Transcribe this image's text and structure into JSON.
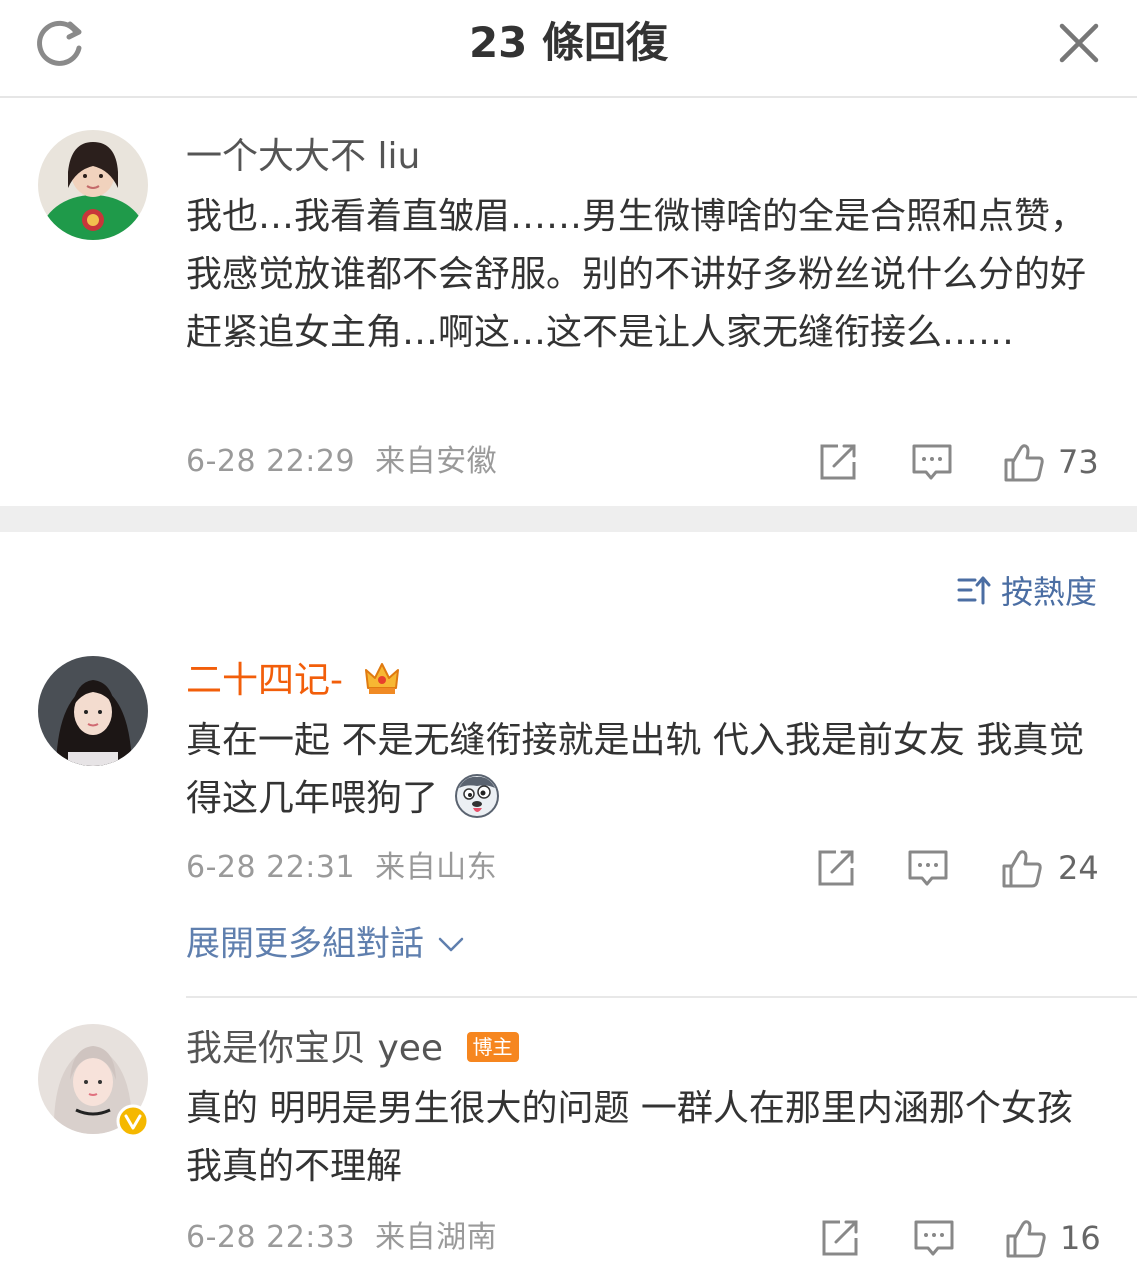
{
  "header": {
    "title": "23 條回復",
    "refresh_icon": "refresh-icon",
    "close_icon": "close-icon"
  },
  "sort_label": "按熱度",
  "expand_label": "展開更多組對話",
  "comments": [
    {
      "username": "一个大大不 liu",
      "text": "我也…我看着直皱眉……男生微博啥的全是合照和点赞，我感觉放谁都不会舒服。别的不讲好多粉丝说什么分的好赶紧追女主角…啊这…这不是让人家无缝衔接么……",
      "time": "6-28 22:29",
      "location": "来自安徽",
      "likes": "73"
    },
    {
      "username": "二十四记-",
      "username_color": "#f25e0a",
      "text": "真在一起 不是无缝衔接就是出轨 代入我是前女友 我真觉得这几年喂狗了",
      "time": "6-28 22:31",
      "location": "来自山东",
      "likes": "24"
    },
    {
      "username": "我是你宝贝 yee",
      "badge": "博主",
      "text": "真的 明明是男生很大的问题 一群人在那里内涵那个女孩 我真的不理解",
      "time": "6-28 22:33",
      "location": "来自湖南",
      "likes": "16"
    }
  ],
  "colors": {
    "accent_blue": "#5f7fae",
    "vip_orange": "#f25e0a",
    "badge_orange": "#f6861f",
    "verified_yellow": "#f5b800"
  }
}
